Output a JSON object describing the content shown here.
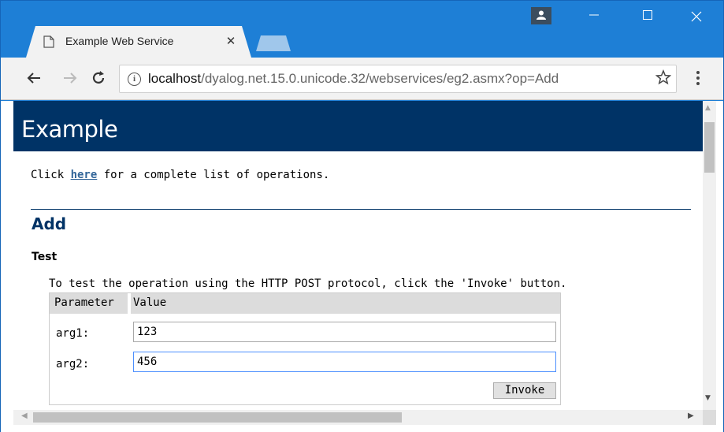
{
  "tab": {
    "title": "Example Web Service",
    "close_label": "✕"
  },
  "toolbar": {
    "url_host": "localhost",
    "url_path": "/dyalog.net.15.0.unicode.32/webservices/eg2.asmx?op=Add"
  },
  "page": {
    "header": "Example",
    "intro_prefix": "Click ",
    "intro_link": "here",
    "intro_suffix": " for a complete list of operations.",
    "operation_title": "Add",
    "section_title": "Test",
    "description": "To test the operation using the HTTP POST protocol, click the 'Invoke' button.",
    "table": {
      "col_parameter": "Parameter",
      "col_value": "Value",
      "rows": [
        {
          "label": "arg1:",
          "value": "123"
        },
        {
          "label": "arg2:",
          "value": "456"
        }
      ]
    },
    "invoke_label": "Invoke"
  },
  "colors": {
    "titlebar": "#1e7fd6",
    "page_header": "#003366",
    "link": "#336699",
    "focus": "#4d90fe"
  }
}
